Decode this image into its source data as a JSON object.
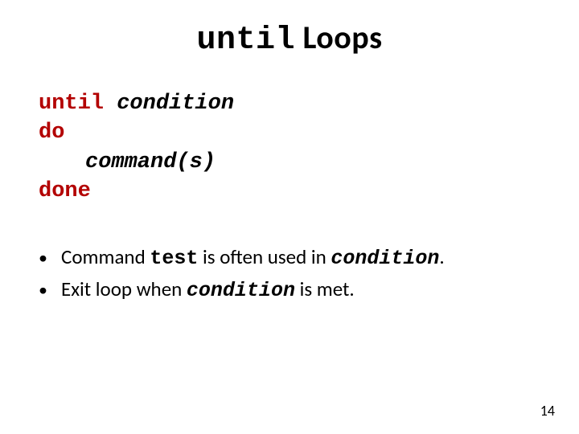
{
  "title": {
    "mono": "until",
    "rest": " Loops"
  },
  "code": {
    "l1_kw": "until ",
    "l1_arg": "condition",
    "l2": "do",
    "l3": "command(s)",
    "l4": "done"
  },
  "bullets": {
    "b1_pre": "Command ",
    "b1_code": "test",
    "b1_mid": " is often used in ",
    "b1_cond": "condition",
    "b1_post": ".",
    "b2_pre": "Exit loop when ",
    "b2_cond": "condition",
    "b2_post": "  is met."
  },
  "page": "14"
}
